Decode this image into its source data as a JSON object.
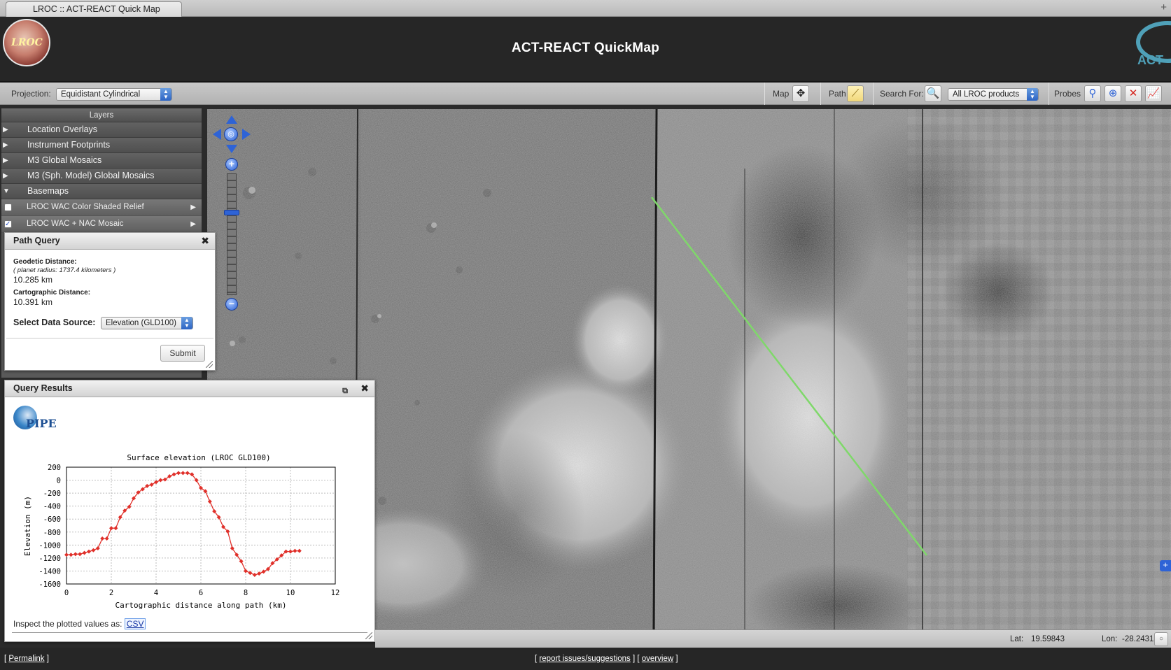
{
  "browser": {
    "tab_title": "LROC :: ACT-REACT Quick Map",
    "new_tab": "+"
  },
  "header": {
    "title": "ACT-REACT QuickMap",
    "logo_left_text": "LROC",
    "logo_right_text": "ACT"
  },
  "toolbar": {
    "projection_label": "Projection:",
    "projection_value": "Equidistant Cylindrical",
    "map_label": "Map",
    "path_label": "Path",
    "search_label": "Search For:",
    "search_value": "All LROC products",
    "probes_label": "Probes"
  },
  "layers": {
    "title": "Layers",
    "groups": [
      {
        "label": "Location Overlays",
        "expanded": false
      },
      {
        "label": "Instrument Footprints",
        "expanded": false
      },
      {
        "label": "M3 Global Mosaics",
        "expanded": false
      },
      {
        "label": "M3 (Sph. Model) Global Mosaics",
        "expanded": false
      },
      {
        "label": "Basemaps",
        "expanded": true
      }
    ],
    "basemaps": [
      {
        "label": "LROC WAC Color Shaded Relief",
        "checked": false
      },
      {
        "label": "LROC WAC + NAC Mosaic",
        "checked": true
      }
    ]
  },
  "path_query": {
    "title": "Path Query",
    "geodetic_label": "Geodetic Distance:",
    "geodetic_note": "( planet radius: 1737.4 kilometers )",
    "geodetic_value": "10.285 km",
    "cartographic_label": "Cartographic Distance:",
    "cartographic_value": "10.391 km",
    "source_label": "Select Data Source:",
    "source_value": "Elevation (GLD100)",
    "submit_label": "Submit"
  },
  "query_results": {
    "title": "Query Results",
    "logo_text": "PIPE",
    "inspect_label": "Inspect the plotted values as:",
    "csv_link": "CSV"
  },
  "chart_data": {
    "type": "line",
    "title": "Surface elevation (LROC GLD100)",
    "xlabel": "Cartographic distance along path (km)",
    "ylabel": "Elevation (m)",
    "xlim": [
      0,
      12
    ],
    "ylim": [
      -1600,
      200
    ],
    "xticks": [
      0,
      2,
      4,
      6,
      8,
      10,
      12
    ],
    "yticks": [
      200,
      0,
      -200,
      -400,
      -600,
      -800,
      -1000,
      -1200,
      -1400,
      -1600
    ],
    "grid": true,
    "color": "#e0302a",
    "series": [
      {
        "x": [
          0,
          0.2,
          0.4,
          0.6,
          0.8,
          1.0,
          1.2,
          1.4,
          1.6,
          1.8,
          2.0,
          2.2,
          2.4,
          2.6,
          2.8,
          3.0,
          3.2,
          3.4,
          3.6,
          3.8,
          4.0,
          4.2,
          4.4,
          4.6,
          4.8,
          5.0,
          5.2,
          5.4,
          5.6,
          5.8,
          6.0,
          6.2,
          6.4,
          6.6,
          6.8,
          7.0,
          7.2,
          7.4,
          7.6,
          7.8,
          8.0,
          8.2,
          8.4,
          8.6,
          8.8,
          9.0,
          9.2,
          9.4,
          9.6,
          9.8,
          10.0,
          10.2,
          10.4
        ],
        "y": [
          -1150,
          -1150,
          -1140,
          -1140,
          -1120,
          -1100,
          -1080,
          -1050,
          -900,
          -900,
          -740,
          -740,
          -570,
          -470,
          -410,
          -280,
          -190,
          -140,
          -90,
          -70,
          -30,
          0,
          10,
          60,
          90,
          110,
          110,
          110,
          90,
          0,
          -120,
          -170,
          -330,
          -480,
          -570,
          -720,
          -790,
          -1050,
          -1150,
          -1250,
          -1400,
          -1430,
          -1460,
          -1440,
          -1410,
          -1370,
          -1280,
          -1220,
          -1160,
          -1100,
          -1100,
          -1090,
          -1090
        ]
      }
    ]
  },
  "status": {
    "lat_label": "Lat:",
    "lat_value": "19.59843",
    "lon_label": "Lon:",
    "lon_value": "-28.24315"
  },
  "footer": {
    "permalink": "Permalink",
    "report": "report issues/suggestions",
    "overview": "overview"
  }
}
